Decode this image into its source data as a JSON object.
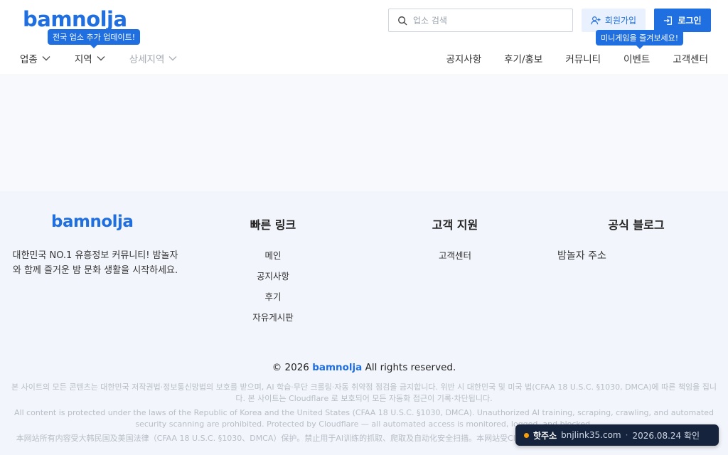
{
  "header": {
    "logo": "bamnolja",
    "update_tip": "전국 업소 추가 업데이트!",
    "game_tip": "미니게임을 즐겨보세요!",
    "search": {
      "placeholder": "업소 검색",
      "value": ""
    },
    "signup_label": "회원가입",
    "login_label": "로그인",
    "nav_left": [
      {
        "label": "업종",
        "icon": "chevron-down-icon"
      },
      {
        "label": "지역",
        "icon": "chevron-down-icon"
      },
      {
        "label": "상세지역",
        "icon": "chevron-down-icon"
      }
    ],
    "nav_right": [
      "공지사항",
      "후기/홍보",
      "커뮤니티",
      "이벤트",
      "고객센터"
    ]
  },
  "footer": {
    "logo": "bamnolja",
    "desc": "대한민국 NO.1 유흥정보 커뮤니티! 밤놀자와 함께 즐거운 밤 문화 생활을 시작하세요.",
    "quick_links": {
      "title": "빠른 링크",
      "items": [
        "메인",
        "공지사항",
        "후기",
        "자유게시판"
      ]
    },
    "support": {
      "title": "고객 지원",
      "items": [
        "고객센터"
      ]
    },
    "blog": {
      "title": "공식 블로그",
      "items": [
        "밤놀자 주소"
      ]
    },
    "copyright_prefix": "© 2026",
    "copyright_brand": "bamnolja",
    "copyright_suffix": "All rights reserved.",
    "legal_ko": "본 사이트의 모든 콘텐츠는 대한민국 저작권법·정보통신망법의 보호를 받으며, AI 학습·무단 크롤링·자동 취약점 점검을 금지합니다. 위반 시 대한민국 및 미국 법(CFAA 18 U.S.C. §1030, DMCA)에 따른 책임을 집니다. 본 사이트는 Cloudflare 로 보호되어 모든 자동화 접근이 기록·차단됩니다.",
    "legal_en": "All content is protected under the laws of the Republic of Korea and the United States (CFAA 18 U.S.C. §1030, DMCA). Unauthorized AI training, scraping, crawling, and automated security scanning are prohibited. Protected by Cloudflare — all automated access is monitored, logged, and blocked.",
    "legal_zh": "本网站所有内容受大韩民国及美国法律（CFAA 18 U.S.C. §1030、DMCA）保护。禁止用于AI训练的抓取、爬取及自动化安全扫描。本网站受Cloudflare保护，所有自动化访问均被监控、记录并拦截。"
  },
  "hot_badge": {
    "title": "핫주소",
    "domain": "bnjlink35.com",
    "separator": "·",
    "date": "2026.08.24 확인"
  }
}
